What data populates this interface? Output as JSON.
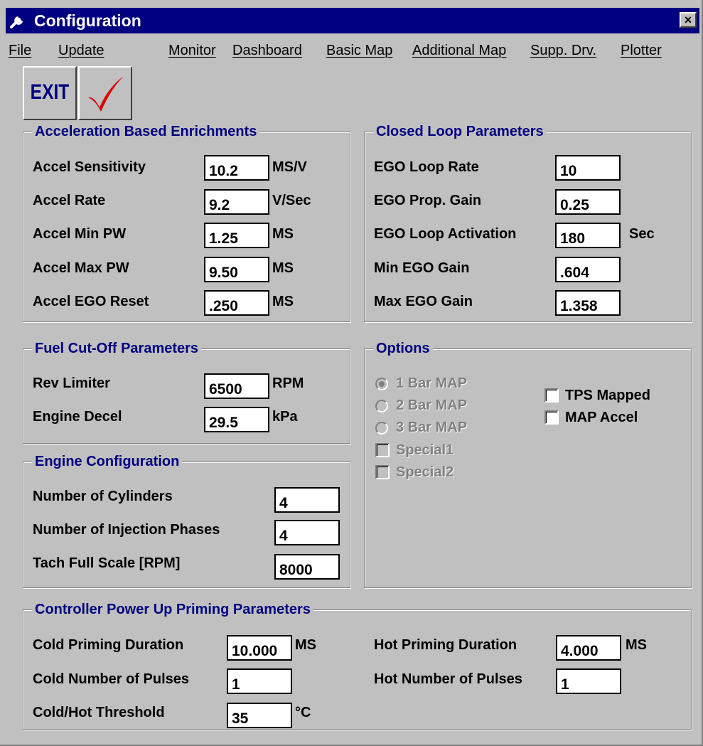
{
  "window": {
    "title": "Configuration",
    "close_glyph": "×",
    "title_icon": "wrench-icon"
  },
  "menu": {
    "items": [
      "File",
      "Update",
      "Monitor",
      "Dashboard",
      "Basic Map",
      "Additional Map",
      "Supp. Drv.",
      "Plotter"
    ]
  },
  "toolbar": {
    "exit_label": "EXIT",
    "check_icon": "checkmark-icon",
    "check_color": "#e00000"
  },
  "accel": {
    "title": "Acceleration Based Enrichments",
    "rows": [
      {
        "label": "Accel Sensitivity",
        "value": "10.2",
        "unit": "MS/V"
      },
      {
        "label": "Accel Rate",
        "value": "9.2",
        "unit": "V/Sec"
      },
      {
        "label": "Accel Min PW",
        "value": "1.25",
        "unit": "MS"
      },
      {
        "label": "Accel Max PW",
        "value": "9.50",
        "unit": "MS"
      },
      {
        "label": "Accel EGO Reset",
        "value": ".250",
        "unit": "MS"
      }
    ]
  },
  "closed_loop": {
    "title": "Closed Loop Parameters",
    "rows": [
      {
        "label": "EGO Loop Rate",
        "value": "10",
        "unit": ""
      },
      {
        "label": "EGO Prop. Gain",
        "value": "0.25",
        "unit": ""
      },
      {
        "label": "EGO Loop Activation",
        "value": "180",
        "unit": "Sec"
      },
      {
        "label": "Min EGO Gain",
        "value": ".604",
        "unit": ""
      },
      {
        "label": "Max EGO Gain",
        "value": "1.358",
        "unit": ""
      }
    ]
  },
  "fuel_cut": {
    "title": "Fuel Cut-Off Parameters",
    "rows": [
      {
        "label": "Rev Limiter",
        "value": "6500",
        "unit": "RPM"
      },
      {
        "label": "Engine Decel",
        "value": "29.5",
        "unit": "kPa"
      }
    ]
  },
  "options": {
    "title": "Options",
    "radios": [
      {
        "label": "1 Bar MAP",
        "selected": true
      },
      {
        "label": "2 Bar MAP",
        "selected": false
      },
      {
        "label": "3 Bar MAP",
        "selected": false
      }
    ],
    "disabled_checks": [
      "Special1",
      "Special2"
    ],
    "checks": [
      {
        "label": "TPS Mapped",
        "checked": false
      },
      {
        "label": "MAP Accel",
        "checked": false
      }
    ]
  },
  "engine": {
    "title": "Engine Configuration",
    "rows": [
      {
        "label": "Number of Cylinders",
        "value": "4"
      },
      {
        "label": "Number of Injection Phases",
        "value": "4"
      },
      {
        "label": "Tach Full Scale [RPM]",
        "value": "8000"
      }
    ]
  },
  "priming": {
    "title": "Controller Power Up Priming Parameters",
    "cold": [
      {
        "label": "Cold Priming Duration",
        "value": "10.000",
        "unit": "MS"
      },
      {
        "label": "Cold Number of Pulses",
        "value": "1",
        "unit": ""
      },
      {
        "label": "Cold/Hot Threshold",
        "value": "35",
        "unit": "°C"
      }
    ],
    "hot": [
      {
        "label": "Hot Priming Duration",
        "value": "4.000",
        "unit": "MS"
      },
      {
        "label": "Hot Number of Pulses",
        "value": "1",
        "unit": ""
      }
    ]
  }
}
